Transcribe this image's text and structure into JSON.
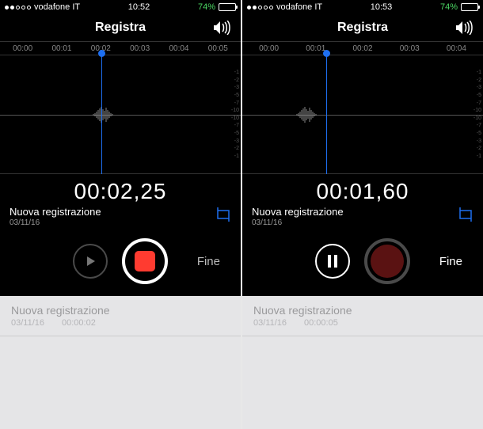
{
  "phones": {
    "left": {
      "status": {
        "carrier": "vodafone IT",
        "time": "10:52",
        "battery": "74%"
      },
      "nav": {
        "title": "Registra"
      },
      "timeline": [
        "00:00",
        "00:01",
        "00:02",
        "00:03",
        "00:04",
        "00:05"
      ],
      "db_scale": [
        "-1",
        "-2",
        "-3",
        "-5",
        "-7",
        "-10",
        "-10",
        "-7",
        "-5",
        "-3",
        "-2",
        "-1"
      ],
      "timer": "00:02,25",
      "recording": {
        "title": "Nuova registrazione",
        "date": "03/11/16"
      },
      "buttons": {
        "play_label": "play-icon",
        "record_label": "record/stop",
        "done": "Fine"
      },
      "list": {
        "title": "Nuova registrazione",
        "date": "03/11/16",
        "duration": "00:00:02"
      }
    },
    "right": {
      "status": {
        "carrier": "vodafone IT",
        "time": "10:53",
        "battery": "74%"
      },
      "nav": {
        "title": "Registra"
      },
      "timeline": [
        "00:00",
        "00:01",
        "00:02",
        "00:03",
        "00:04"
      ],
      "db_scale": [
        "-1",
        "-2",
        "-3",
        "-5",
        "-7",
        "-10",
        "-10",
        "-7",
        "-5",
        "-3",
        "-2",
        "-1"
      ],
      "timer": "00:01,60",
      "recording": {
        "title": "Nuova registrazione",
        "date": "03/11/16"
      },
      "buttons": {
        "pause_label": "pause-icon",
        "record_label": "record",
        "done": "Fine"
      },
      "list": {
        "title": "Nuova registrazione",
        "date": "03/11/16",
        "duration": "00:00:05"
      }
    }
  }
}
